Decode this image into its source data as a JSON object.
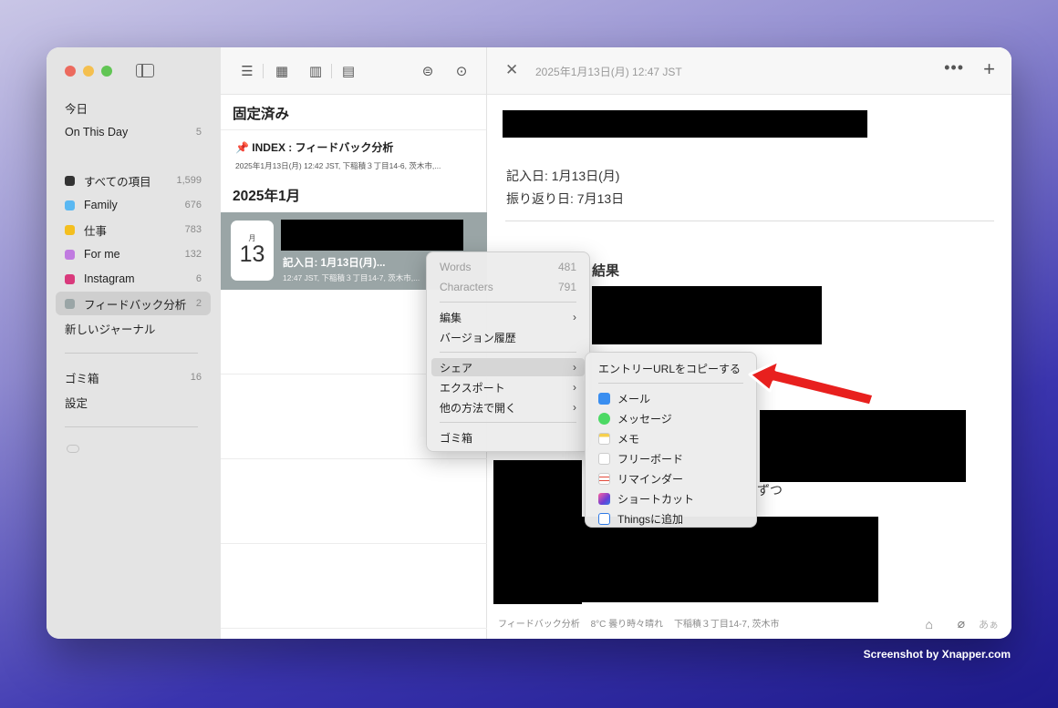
{
  "sidebar": {
    "top_items": [
      {
        "label": "今日",
        "count": ""
      },
      {
        "label": "On This Day",
        "count": "5"
      }
    ],
    "journals": [
      {
        "label": "すべての項目",
        "count": "1,599",
        "color": "#333333"
      },
      {
        "label": "Family",
        "count": "676",
        "color": "#5ab8f2"
      },
      {
        "label": "仕事",
        "count": "783",
        "color": "#f4bf1f"
      },
      {
        "label": "For me",
        "count": "132",
        "color": "#c07be0"
      },
      {
        "label": "Instagram",
        "count": "6",
        "color": "#d93a7c"
      },
      {
        "label": "フィードバック分析",
        "count": "2",
        "color": "#9aa5a6"
      }
    ],
    "new_journal": "新しいジャーナル",
    "bottom_items": [
      {
        "label": "ゴミ箱",
        "count": "16"
      },
      {
        "label": "設定",
        "count": ""
      }
    ]
  },
  "list": {
    "pinned_header": "固定済み",
    "pinned": {
      "title": "📌 INDEX : フィードバック分析",
      "meta": "2025年1月13日(月) 12:42 JST,  下稲積３丁目14-6, 茨木市,..."
    },
    "month_header": "2025年1月",
    "entry": {
      "month": "月",
      "day": "13",
      "text": "記入日: 1月13日(月)...",
      "meta": "12:47 JST,  下稲積３丁目14-7, 茨木市,..."
    }
  },
  "detail": {
    "date": "2025年1月13日(月) 12:47 JST",
    "lines": [
      "記入日: 1月13日(月)",
      "振り返り日: 7月13日"
    ],
    "partial_heading": "結果",
    "partial_text_1": "ずつ",
    "partial_text_2": "",
    "footer": {
      "journal": "フィードバック分析",
      "weather": "8°C 曇り時々晴れ",
      "location": "下稲積３丁目14-7, 茨木市"
    },
    "font_button": "あぁ"
  },
  "context_menu": {
    "words_label": "Words",
    "words_value": "481",
    "chars_label": "Characters",
    "chars_value": "791",
    "edit": "編集",
    "history": "バージョン履歴",
    "share": "シェア",
    "export": "エクスポート",
    "open_other": "他の方法で開く",
    "trash": "ゴミ箱"
  },
  "share_menu": {
    "copy_url": "エントリーURLをコピーする",
    "items": [
      {
        "label": "メール",
        "color": "#3a8ef0"
      },
      {
        "label": "メッセージ",
        "color": "#4cd964"
      },
      {
        "label": "メモ",
        "color": "#f6d04d"
      },
      {
        "label": "フリーボード",
        "color": "#ffffff"
      },
      {
        "label": "リマインダー",
        "color": "#ffffff"
      },
      {
        "label": "ショートカット",
        "color": "#6a3fd6"
      },
      {
        "label": "Thingsに追加",
        "color": "#2f7ae5"
      }
    ]
  },
  "watermark": "Screenshot by Xnapper.com"
}
